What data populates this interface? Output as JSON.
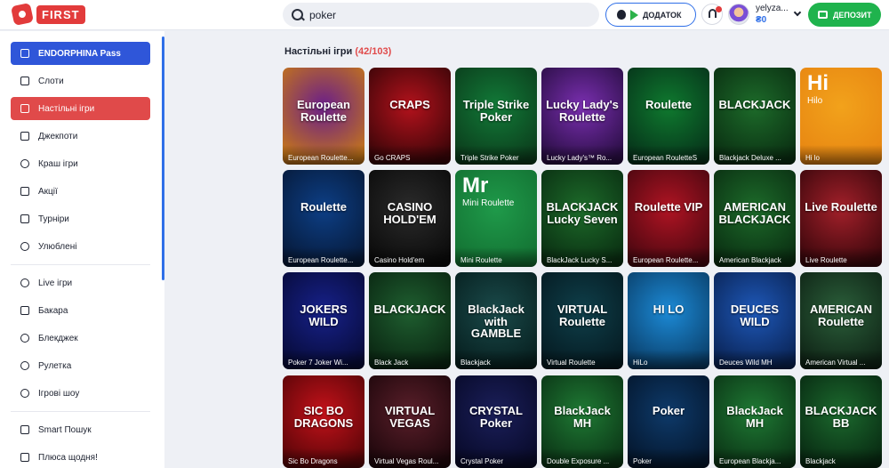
{
  "header": {
    "logo_text": "FIRST",
    "search_value": "poker",
    "app_button_label": "ДОДАТОК",
    "user_name": "yelyza...",
    "balance": "₴0",
    "deposit_label": "ДЕПОЗИТ"
  },
  "sidebar": {
    "items": [
      {
        "label": "ENDORPHINA Pass",
        "icon": "pass-icon"
      },
      {
        "label": "Слоти",
        "icon": "slot-icon"
      },
      {
        "label": "Настільні ігри",
        "icon": "table-games-icon"
      },
      {
        "label": "Джекпоти",
        "icon": "jackpot-icon"
      },
      {
        "label": "Краш ігри",
        "icon": "rocket-icon"
      },
      {
        "label": "Акції",
        "icon": "promo-icon"
      },
      {
        "label": "Турніри",
        "icon": "trophy-icon"
      },
      {
        "label": "Улюблені",
        "icon": "heart-icon"
      },
      {
        "label": "Live ігри",
        "icon": "live-icon"
      },
      {
        "label": "Бакара",
        "icon": "baccarat-icon"
      },
      {
        "label": "Блекджек",
        "icon": "spade-icon"
      },
      {
        "label": "Рулетка",
        "icon": "roulette-icon"
      },
      {
        "label": "Ігрові шоу",
        "icon": "show-icon"
      },
      {
        "label": "Smart Пошук",
        "icon": "smart-search-icon"
      },
      {
        "label": "Плюса щодня!",
        "icon": "gift-icon"
      }
    ]
  },
  "main": {
    "section_title": "Настільні ігри",
    "section_count": "(42/103)",
    "games": [
      {
        "name": "European Roulette...",
        "art": "European Roulette",
        "bg": [
          "#6a1e8a",
          "#c4751a"
        ]
      },
      {
        "name": "Go CRAPS",
        "art": "CRAPS",
        "bg": [
          "#b3121c",
          "#3a0508"
        ]
      },
      {
        "name": "Triple Strike Poker",
        "art": "Triple Strike Poker",
        "bg": [
          "#127a38",
          "#0b3d1c"
        ]
      },
      {
        "name": "Lucky Lady's™ Ro...",
        "art": "Lucky Lady's Roulette",
        "bg": [
          "#7a2fb0",
          "#2a0e45"
        ]
      },
      {
        "name": "European RouletteS",
        "art": "Roulette",
        "bg": [
          "#0f7a2f",
          "#06331a"
        ]
      },
      {
        "name": "Blackjack Deluxe ...",
        "art": "BLACKJACK",
        "bg": [
          "#1d6b2a",
          "#0a2f12"
        ]
      },
      {
        "name": "Hi lo",
        "art": "Hi",
        "sub": "Hilo",
        "bg": [
          "#f2a21b",
          "#e88712"
        ]
      },
      {
        "name": "European Roulette...",
        "art": "Roulette",
        "bg": [
          "#0d3f86",
          "#061a3a"
        ]
      },
      {
        "name": "Casino Hold'em",
        "art": "CASINO HOLD'EM",
        "bg": [
          "#2b2b2b",
          "#0b0b0b"
        ]
      },
      {
        "name": "Mini Roulette",
        "art": "Mr",
        "sub": "Mini Roulette",
        "bg": [
          "#1f9a4a",
          "#137233"
        ]
      },
      {
        "name": "BlackJack Lucky S...",
        "art": "BLACKJACK Lucky Seven",
        "bg": [
          "#1d6b2a",
          "#0a2f12"
        ]
      },
      {
        "name": "European Roulette...",
        "art": "Roulette VIP",
        "bg": [
          "#b01423",
          "#4a0710"
        ]
      },
      {
        "name": "American Blackjack",
        "art": "AMERICAN BLACKJACK",
        "bg": [
          "#1d6b2a",
          "#0a2f12"
        ]
      },
      {
        "name": "Live Roulette",
        "art": "Live Roulette",
        "bg": [
          "#a3202a",
          "#3b070c"
        ]
      },
      {
        "name": "Poker 7 Joker Wi...",
        "art": "JOKERS WILD",
        "bg": [
          "#17218a",
          "#070b3a"
        ]
      },
      {
        "name": "Black Jack",
        "art": "BLACKJACK",
        "bg": [
          "#1f5f30",
          "#0a2612"
        ]
      },
      {
        "name": "Blackjack",
        "art": "BlackJack with GAMBLE",
        "bg": [
          "#1a4a4a",
          "#072020"
        ]
      },
      {
        "name": "Virtual Roulette",
        "art": "VIRTUAL Roulette",
        "bg": [
          "#0f3f4a",
          "#051b22"
        ]
      },
      {
        "name": "HiLo",
        "art": "HI LO",
        "bg": [
          "#1c8ad6",
          "#0a3f6a"
        ]
      },
      {
        "name": "Deuces Wild MH",
        "art": "DEUCES WILD",
        "bg": [
          "#1e58b8",
          "#0a2456"
        ]
      },
      {
        "name": "American Virtual ...",
        "art": "AMERICAN Roulette",
        "bg": [
          "#2b5f3a",
          "#0f2416"
        ]
      },
      {
        "name": "Sic Bo Dragons",
        "art": "SIC BO DRAGONS",
        "bg": [
          "#c4121a",
          "#5a0508"
        ]
      },
      {
        "name": "Virtual Vegas Roul...",
        "art": "VIRTUAL VEGAS",
        "bg": [
          "#5a1f2a",
          "#1f070c"
        ]
      },
      {
        "name": "Crystal Poker",
        "art": "CRYSTAL Poker",
        "bg": [
          "#1b1f5a",
          "#080a2a"
        ]
      },
      {
        "name": "Double Exposure ...",
        "art": "BlackJack MH",
        "bg": [
          "#1f7a34",
          "#0b3516"
        ]
      },
      {
        "name": "Poker",
        "art": "Poker",
        "bg": [
          "#0e3a6a",
          "#04172e"
        ]
      },
      {
        "name": "European Blackja...",
        "art": "BlackJack MH",
        "bg": [
          "#1f7a34",
          "#0b3516"
        ]
      },
      {
        "name": "Blackjack",
        "art": "BLACKJACK BB",
        "bg": [
          "#1c6a2e",
          "#082a12"
        ]
      }
    ]
  },
  "colors": {
    "brand": "#e23b3b",
    "accent": "#2f6fe8",
    "deposit": "#1fb34d"
  }
}
